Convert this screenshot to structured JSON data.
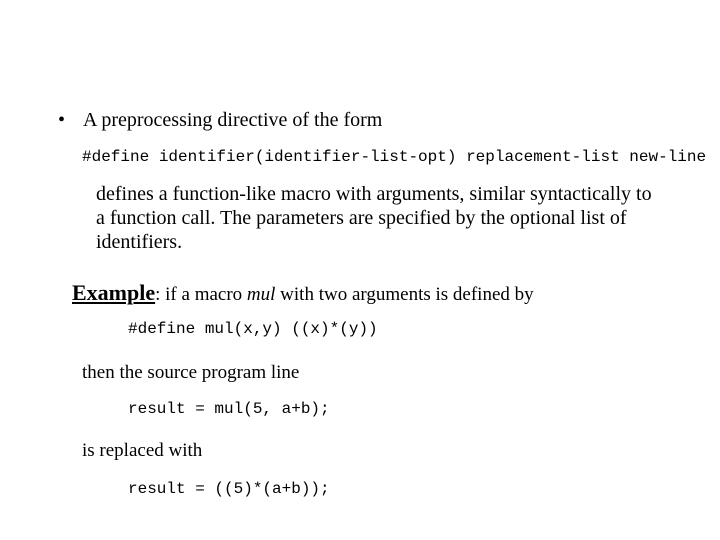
{
  "bullet": {
    "marker": "•",
    "text": "A preprocessing directive of the form"
  },
  "syntax_line": "#define identifier(identifier-list-opt) replacement-list new-line",
  "defines_para": "defines a function-like macro with arguments, similar syntactically to a function call.  The parameters are specified by the optional list of identifiers.",
  "example": {
    "label": "Example",
    "colon_space": ":  ",
    "prefix": "if a macro ",
    "macro_name": "mul",
    "suffix": " with two arguments is defined by"
  },
  "code_define": "#define mul(x,y) ((x)*(y))",
  "then_line": "then the source program line",
  "code_call": "result = mul(5, a+b);",
  "replaced_line": "is replaced with",
  "code_result": "result = ((5)*(a+b));"
}
